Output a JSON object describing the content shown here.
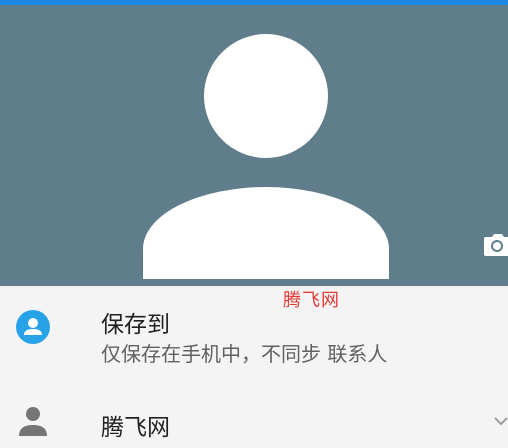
{
  "header": {
    "accent_color": "#1e88e5",
    "photo_background": "#607d8b",
    "avatar_icon": "person-silhouette-icon",
    "camera_icon": "camera-icon"
  },
  "watermark": {
    "text": "腾飞网",
    "color": "#e53935"
  },
  "save_to": {
    "icon": "account-circle-icon",
    "icon_color": "#29a3e8",
    "title": "保存到",
    "subtitle": "仅保存在手机中，不同步 联系人"
  },
  "account": {
    "icon": "person-icon",
    "label": "腾飞网",
    "dropdown_icon": "chevron-down-icon"
  }
}
